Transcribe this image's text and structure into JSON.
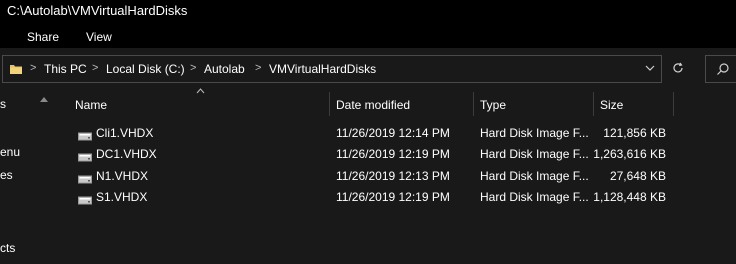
{
  "window": {
    "title": "C:\\Autolab\\VMVirtualHardDisks"
  },
  "ribbon": {
    "tabs": [
      {
        "label": "Share"
      },
      {
        "label": "View"
      }
    ]
  },
  "address": {
    "crumbs": [
      "This PC",
      "Local Disk (C:)",
      "Autolab",
      "VMVirtualHardDisks"
    ],
    "separator": ">",
    "dropdown_icon": "chevron-down-icon",
    "refresh_icon": "refresh-icon",
    "search_icon": "search-icon"
  },
  "nav": {
    "items": [
      "s",
      "enu",
      "es",
      "cts"
    ]
  },
  "columns": {
    "name": "Name",
    "date": "Date modified",
    "type": "Type",
    "size": "Size"
  },
  "files": [
    {
      "name": "Cli1.VHDX",
      "date": "11/26/2019 12:14 PM",
      "type": "Hard Disk Image F...",
      "size": "121,856 KB"
    },
    {
      "name": "DC1.VHDX",
      "date": "11/26/2019 12:19 PM",
      "type": "Hard Disk Image F...",
      "size": "1,263,616 KB"
    },
    {
      "name": "N1.VHDX",
      "date": "11/26/2019 12:13 PM",
      "type": "Hard Disk Image F...",
      "size": "27,648 KB"
    },
    {
      "name": "S1.VHDX",
      "date": "11/26/2019 12:19 PM",
      "type": "Hard Disk Image F...",
      "size": "1,128,448 KB"
    }
  ],
  "colors": {
    "background": "#191919",
    "titlebar": "#000000",
    "text": "#ffffff",
    "border": "#4a4a4a",
    "folder": "#e8c15a"
  }
}
